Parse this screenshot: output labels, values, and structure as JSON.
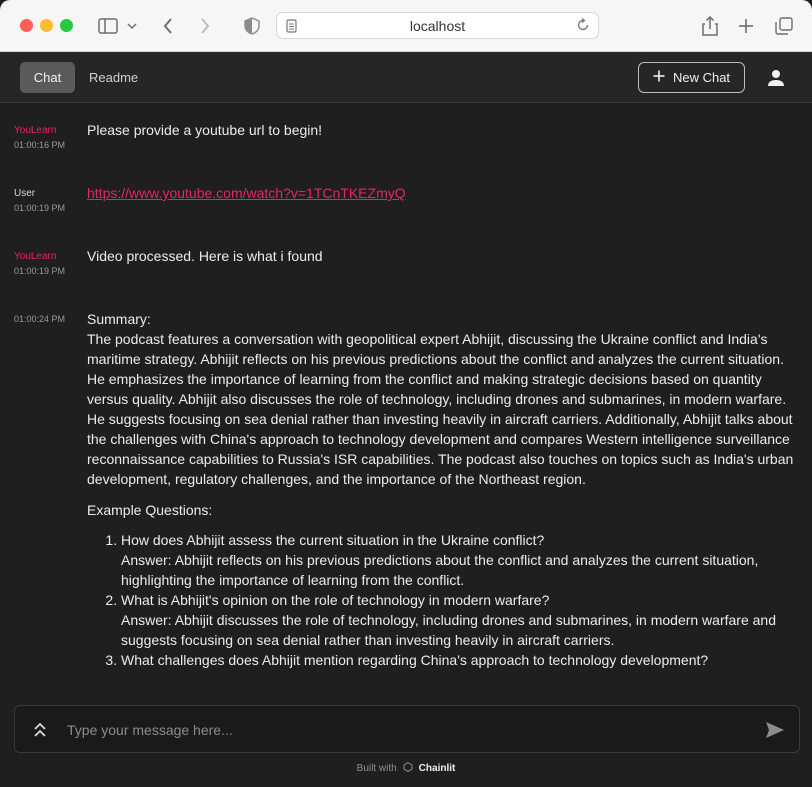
{
  "browser": {
    "address": "localhost",
    "icons": [
      "sidebar-icon",
      "chevron-down-icon",
      "back-icon",
      "forward-icon",
      "shield-icon",
      "share-icon",
      "new-tab-icon",
      "tabs-icon"
    ]
  },
  "header": {
    "tabs": [
      {
        "label": "Chat",
        "active": true
      },
      {
        "label": "Readme",
        "active": false
      }
    ],
    "new_chat_label": "New Chat"
  },
  "messages": [
    {
      "author": "YouLearn",
      "time": "01:00:16 PM",
      "text": "Please provide a youtube url to begin!"
    },
    {
      "author": "User",
      "time": "01:00:19 PM",
      "link": "https://www.youtube.com/watch?v=1TCnTKEZmyQ"
    },
    {
      "author": "YouLearn",
      "time": "01:00:19 PM",
      "text": "Video processed. Here is what i found"
    },
    {
      "author": "",
      "time": "01:00:24 PM",
      "summary_heading": "Summary:",
      "summary_body": "The podcast features a conversation with geopolitical expert Abhijit, discussing the Ukraine conflict and India's maritime strategy. Abhijit reflects on his previous predictions about the conflict and analyzes the current situation. He emphasizes the importance of learning from the conflict and making strategic decisions based on quantity versus quality. Abhijit also discusses the role of technology, including drones and submarines, in modern warfare. He suggests focusing on sea denial rather than investing heavily in aircraft carriers. Additionally, Abhijit talks about the challenges with China's approach to technology development and compares Western intelligence surveillance reconnaissance capabilities to Russia's ISR capabilities. The podcast also touches on topics such as India's urban development, regulatory challenges, and the importance of the Northeast region.",
      "questions_heading": "Example Questions:",
      "questions": [
        {
          "q": "How does Abhijit assess the current situation in the Ukraine conflict?",
          "a": "Answer: Abhijit reflects on his previous predictions about the conflict and analyzes the current situation, highlighting the importance of learning from the conflict."
        },
        {
          "q": "What is Abhijit's opinion on the role of technology in modern warfare?",
          "a": "Answer: Abhijit discusses the role of technology, including drones and submarines, in modern warfare and suggests focusing on sea denial rather than investing heavily in aircraft carriers."
        },
        {
          "q": "What challenges does Abhijit mention regarding China's approach to technology development?",
          "a": ""
        }
      ]
    }
  ],
  "composer": {
    "placeholder": "Type your message here..."
  },
  "footer": {
    "prefix": "Built with",
    "brand": "Chainlit"
  },
  "colors": {
    "accent": "#e8236a",
    "background": "#1f1f1f",
    "header": "#262626"
  }
}
